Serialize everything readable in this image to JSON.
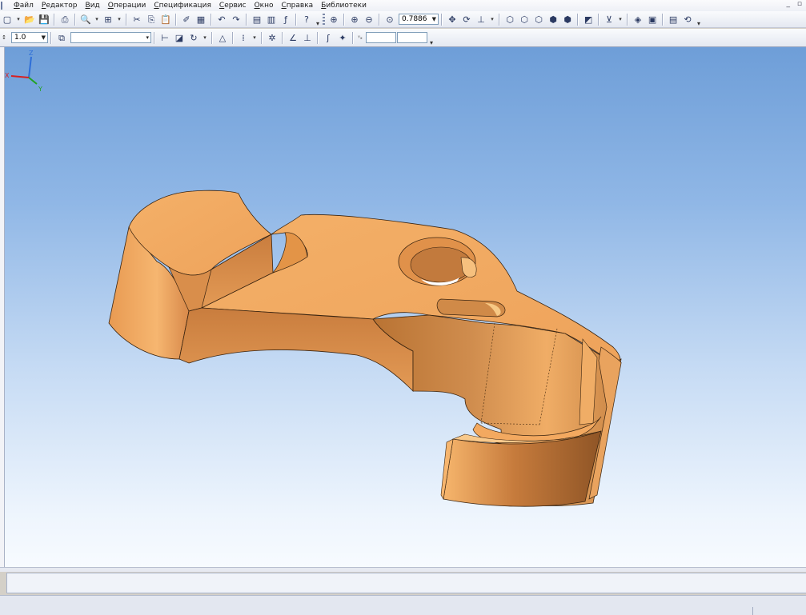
{
  "menu": {
    "items": [
      "Файл",
      "Редактор",
      "Вид",
      "Операции",
      "Спецификация",
      "Сервис",
      "Окно",
      "Справка",
      "Библиотеки"
    ],
    "window_controls": "_ ▫"
  },
  "toolbar1": {
    "zoom_value": "0.7886"
  },
  "toolbar2": {
    "scale_value": "1.0",
    "style_value": ""
  },
  "viewport": {
    "model_color": "#f0a55a",
    "axis_labels": {
      "x": "X",
      "y": "Y",
      "z": "Z"
    }
  },
  "colors": {
    "accent": "#2b3a62",
    "viewport_top": "#6e9ed8",
    "viewport_bottom": "#f7fbff"
  }
}
